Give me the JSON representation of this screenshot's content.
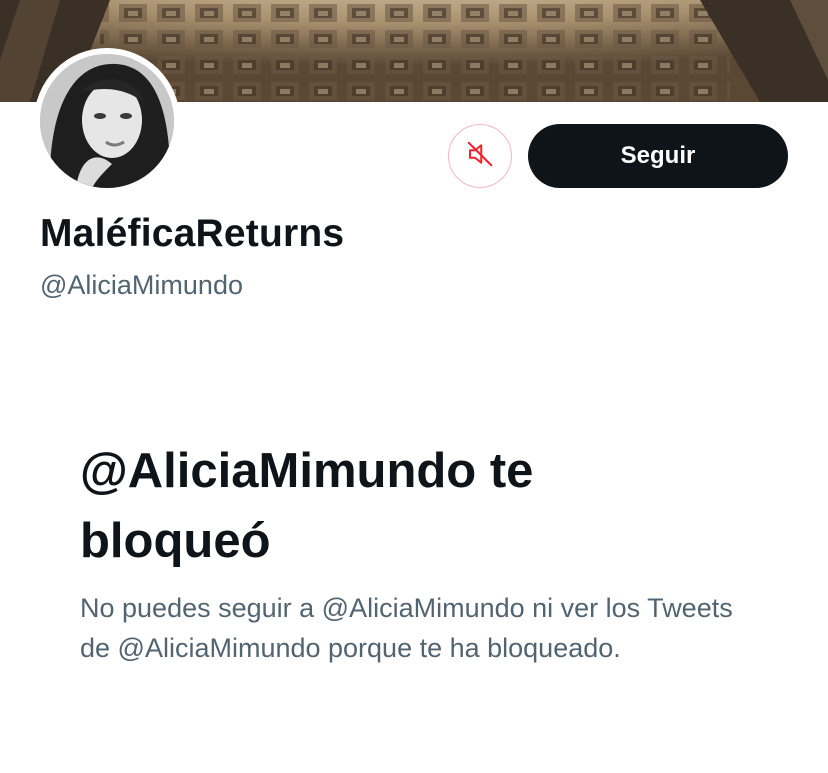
{
  "profile": {
    "display_name": "MaléficaReturns",
    "handle": "@AliciaMimundo"
  },
  "actions": {
    "mute_icon": "speaker-muted-icon",
    "follow_label": "Seguir"
  },
  "blocked_notice": {
    "title": "@AliciaMimundo te bloqueó",
    "message": "No puedes seguir a @AliciaMimundo ni ver los Tweets de @AliciaMimundo porque te ha bloqueado."
  },
  "colors": {
    "primary_text": "#0f1419",
    "secondary_text": "#536471",
    "follow_button_bg": "#0f1419",
    "mute_accent": "#f4212e"
  }
}
